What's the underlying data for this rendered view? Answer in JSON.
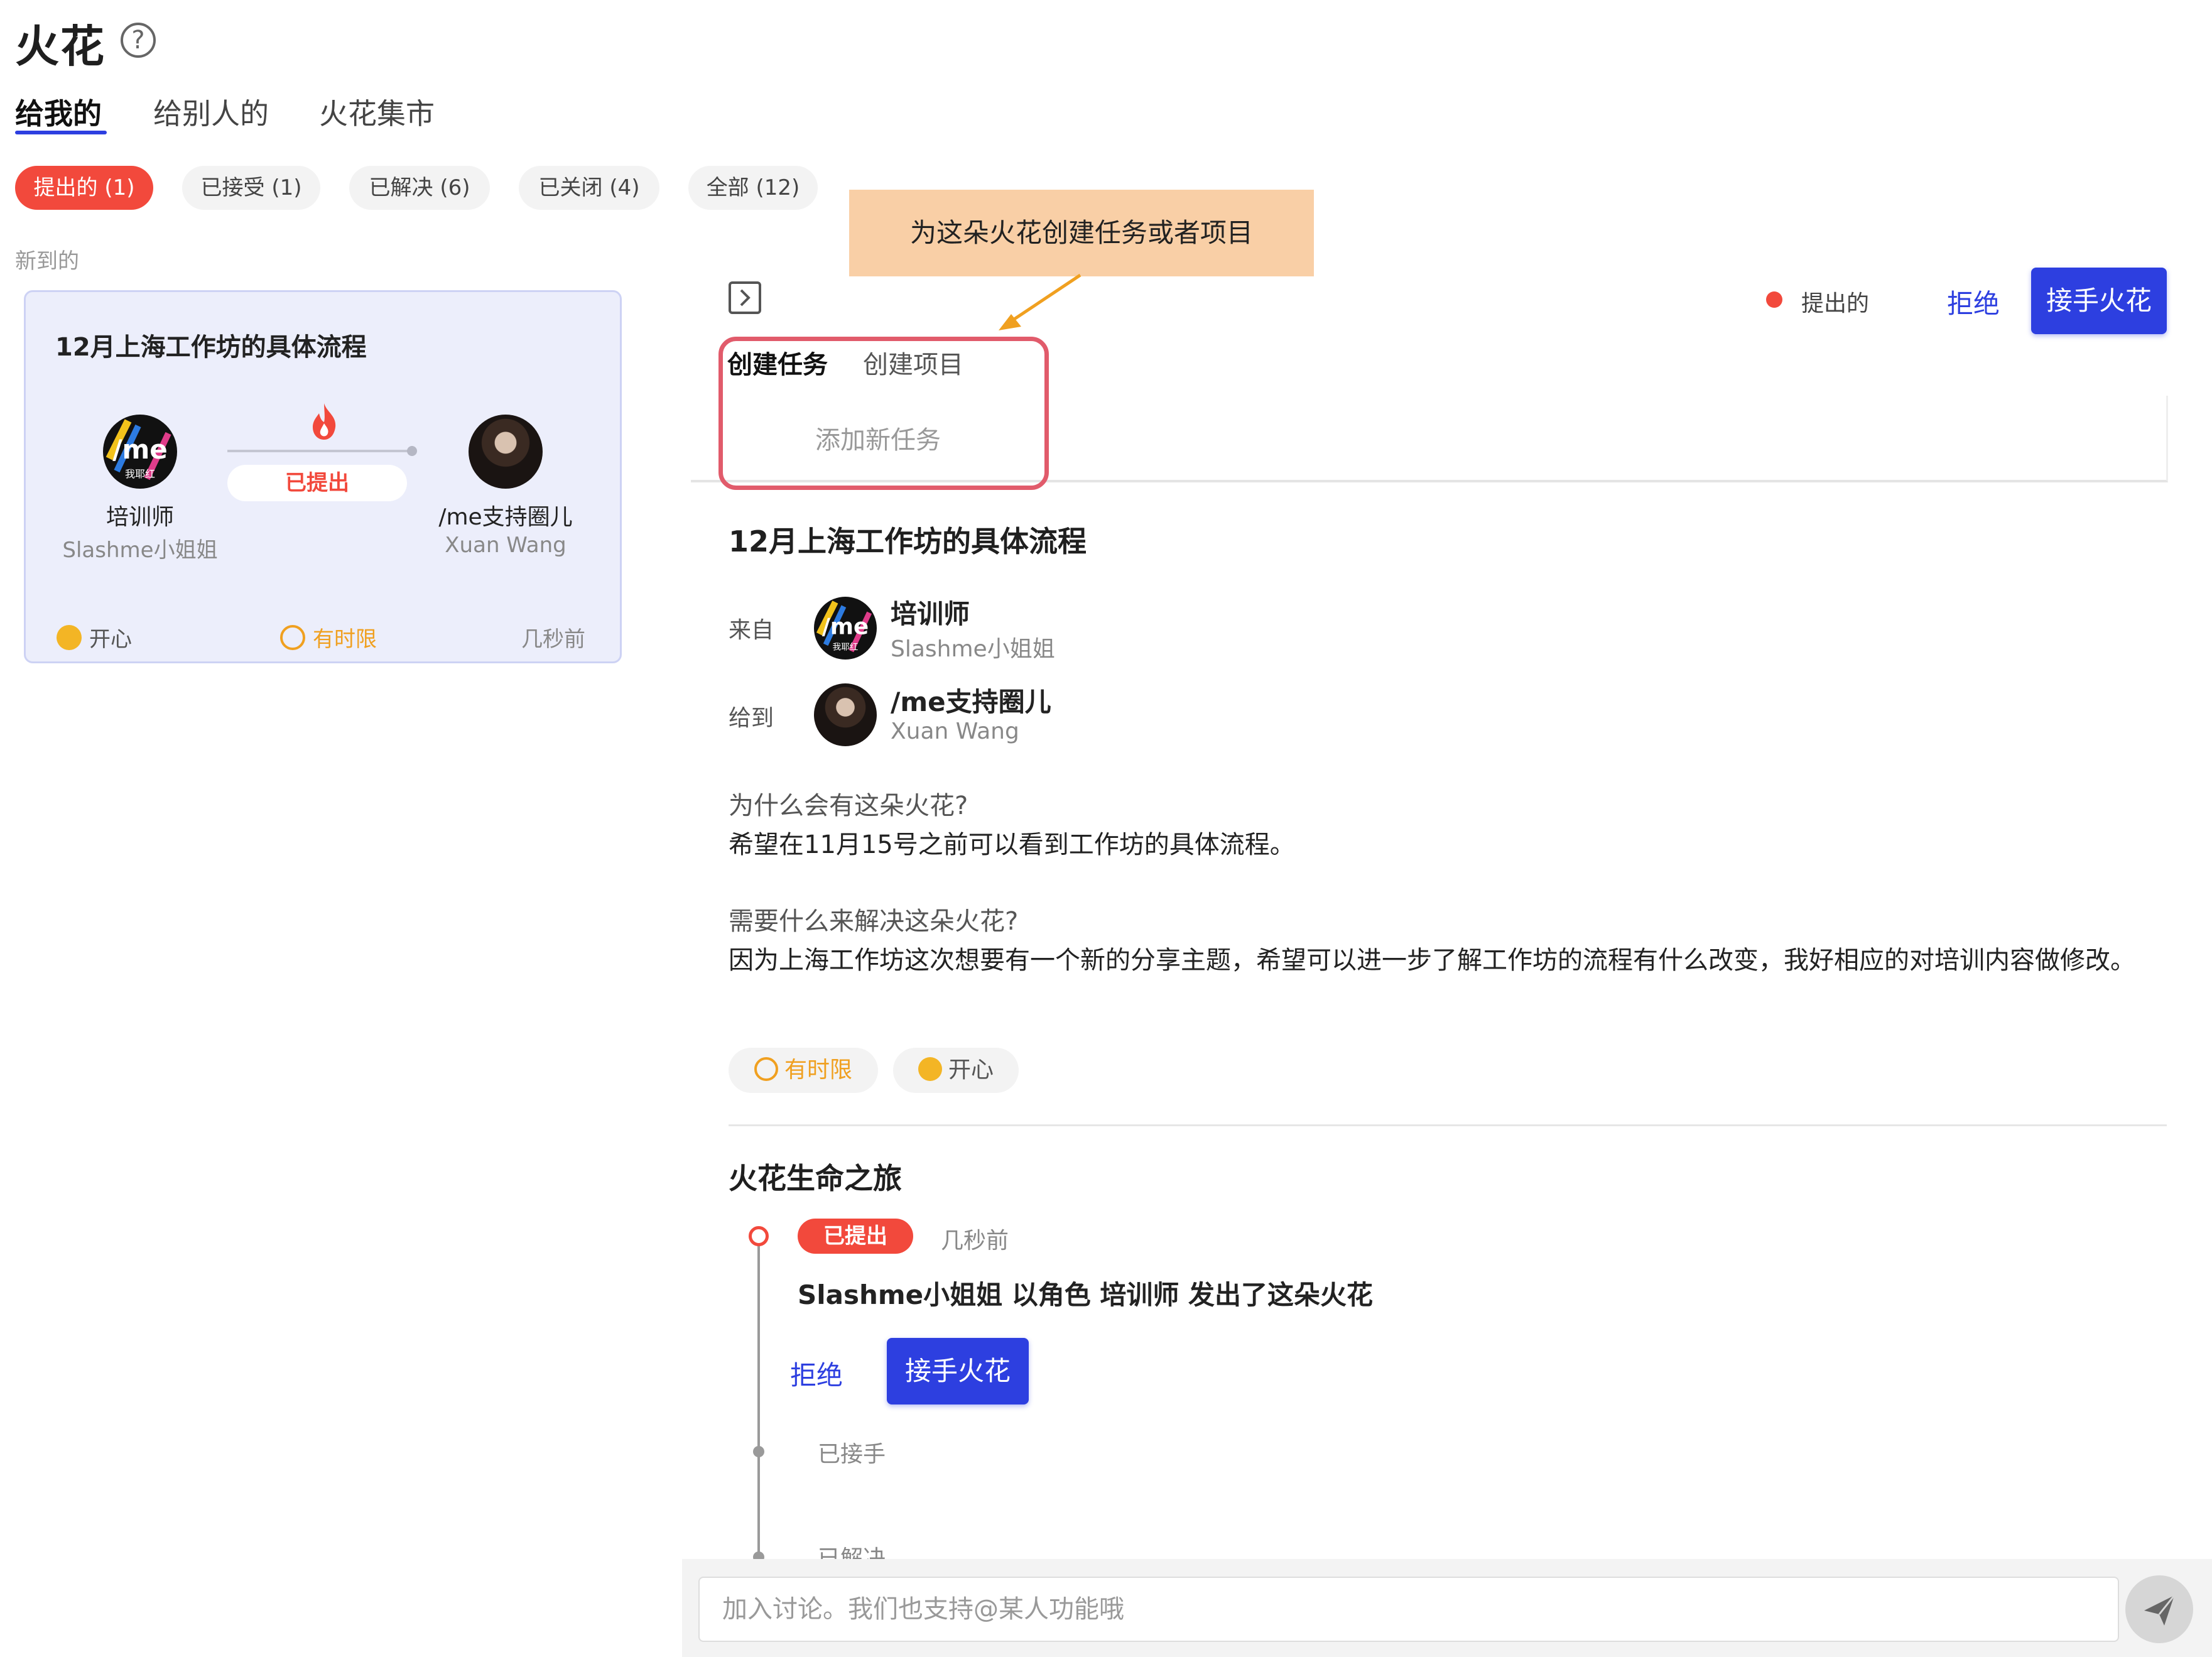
{
  "header": {
    "title": "火花",
    "help_icon": "question-circle-icon"
  },
  "tabs": [
    {
      "label": "给我的"
    },
    {
      "label": "给别人的"
    },
    {
      "label": "火花集市"
    }
  ],
  "filters": [
    {
      "label": "提出的 (1)"
    },
    {
      "label": "已接受 (1)"
    },
    {
      "label": "已解决 (6)"
    },
    {
      "label": "已关闭 (4)"
    },
    {
      "label": "全部 (12)"
    }
  ],
  "list": {
    "section_label": "新到的",
    "card": {
      "title": "12月上海工作坊的具体流程",
      "from_role": "培训师",
      "from_name": "Slashme小姐姐",
      "to_role": "/me支持圈儿",
      "to_name": "Xuan Wang",
      "status": "已提出",
      "mood": "开心",
      "deadline": "有时限",
      "time": "几秒前",
      "logo_text": "/me",
      "logo_sub": "我耶红"
    }
  },
  "annotation": {
    "callout": "为这朵火花创建任务或者项目"
  },
  "detail": {
    "status_label": "提出的",
    "reject_label": "拒绝",
    "accept_label": "接手火花",
    "create_tabs": [
      {
        "label": "创建任务"
      },
      {
        "label": "创建项目"
      }
    ],
    "add_task_label": "添加新任务",
    "title": "12月上海工作坊的具体流程",
    "from_label": "来自",
    "from_role": "培训师",
    "from_name": "Slashme小姐姐",
    "to_label": "给到",
    "to_role": "/me支持圈儿",
    "to_name": "Xuan Wang",
    "why_question": "为什么会有这朵火花?",
    "why_answer": "希望在11月15号之前可以看到工作坊的具体流程。",
    "need_question": "需要什么来解决这朵火花?",
    "need_answer": "因为上海工作坊这次想要有一个新的分享主题，希望可以进一步了解工作坊的流程有什么改变，我好相应的对培训内容做修改。",
    "tags": [
      {
        "label": "有时限"
      },
      {
        "label": "开心"
      }
    ]
  },
  "journey": {
    "title": "火花生命之旅",
    "status_chip": "已提出",
    "time": "几秒前",
    "description": "Slashme小姐姐 以角色 培训师 发出了这朵火花",
    "reject_label": "拒绝",
    "accept_label": "接手火花",
    "step_accepted": "已接手",
    "step_resolved": "已解决"
  },
  "comment": {
    "placeholder": "加入讨论。我们也支持@某人功能哦",
    "send_icon": "paper-plane-icon"
  },
  "colors": {
    "accent": "#2d3fe0",
    "danger": "#f2493c",
    "warning": "#f0a020",
    "callout": "#f9cfa6"
  }
}
